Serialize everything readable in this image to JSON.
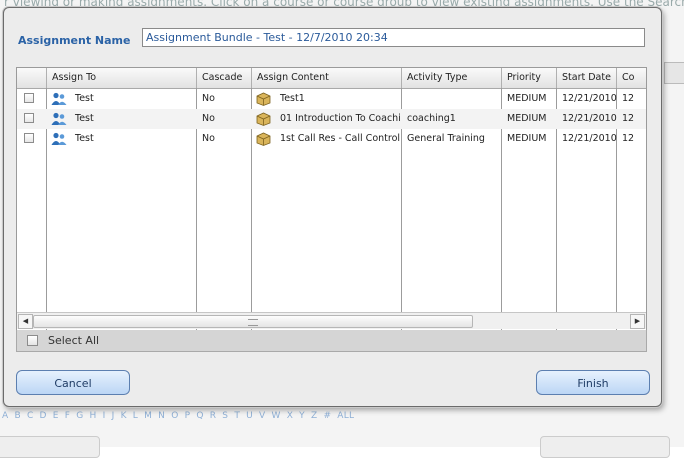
{
  "background": {
    "top_text": "r viewing or making assignments. Click on a course or course group to view existing assignments. Use the Search",
    "alphabet": [
      "A",
      "B",
      "C",
      "D",
      "E",
      "F",
      "G",
      "H",
      "I",
      "J",
      "K",
      "L",
      "M",
      "N",
      "O",
      "P",
      "Q",
      "R",
      "S",
      "T",
      "U",
      "V",
      "W",
      "X",
      "Y",
      "Z",
      "#",
      "ALL"
    ]
  },
  "dialog": {
    "name_label": "Assignment Name",
    "name_value": "Assignment Bundle - Test - 12/7/2010 20:34",
    "columns": [
      "",
      "Assign To",
      "Cascade",
      "Assign Content",
      "Activity Type",
      "Priority",
      "Start Date",
      "Co"
    ],
    "rows": [
      {
        "assign_to": "Test",
        "cascade": "No",
        "content": "Test1",
        "activity": "",
        "priority": "MEDIUM",
        "start": "12/21/2010",
        "co": "12"
      },
      {
        "assign_to": "Test",
        "cascade": "No",
        "content": "01 Introduction To Coachi",
        "activity": "coaching1",
        "priority": "MEDIUM",
        "start": "12/21/2010",
        "co": "12"
      },
      {
        "assign_to": "Test",
        "cascade": "No",
        "content": "1st Call Res - Call Control",
        "activity": "General Training",
        "priority": "MEDIUM",
        "start": "12/21/2010",
        "co": "12"
      }
    ],
    "select_all_label": "Select All",
    "cancel_label": "Cancel",
    "finish_label": "Finish"
  },
  "icons": {
    "users": "users-icon",
    "content": "package-icon",
    "scroll_left": "arrow-left-icon",
    "scroll_right": "arrow-right-icon"
  },
  "colors": {
    "label_blue": "#2a62a6",
    "button_blue": "#bcd6f5",
    "alphabet_blue": "#8fb0d6"
  }
}
